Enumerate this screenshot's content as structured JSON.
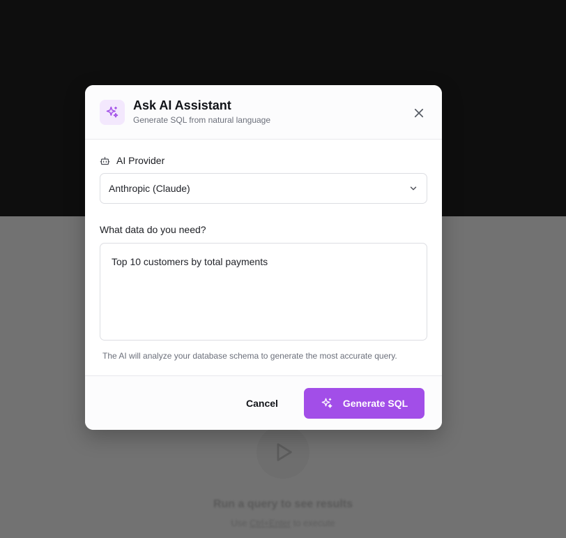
{
  "background": {
    "empty_state_title": "Run a query to see results",
    "empty_state_hint_prefix": "Use",
    "empty_state_hint_key": "Ctrl+Enter",
    "empty_state_hint_suffix": "to execute"
  },
  "modal": {
    "title": "Ask AI Assistant",
    "subtitle": "Generate SQL from natural language",
    "header_icon": "sparkles-icon",
    "close_icon": "close-icon"
  },
  "provider": {
    "label": "AI Provider",
    "icon": "robot-icon",
    "selected": "Anthropic (Claude)"
  },
  "query": {
    "label": "What data do you need?",
    "value": "Top 10 customers by total payments"
  },
  "hint": "The AI will analyze your database schema to generate the most accurate query.",
  "footer": {
    "cancel_label": "Cancel",
    "generate_label": "Generate SQL"
  },
  "colors": {
    "accent": "#a24ee8",
    "accent_light": "#f3e8fd"
  }
}
